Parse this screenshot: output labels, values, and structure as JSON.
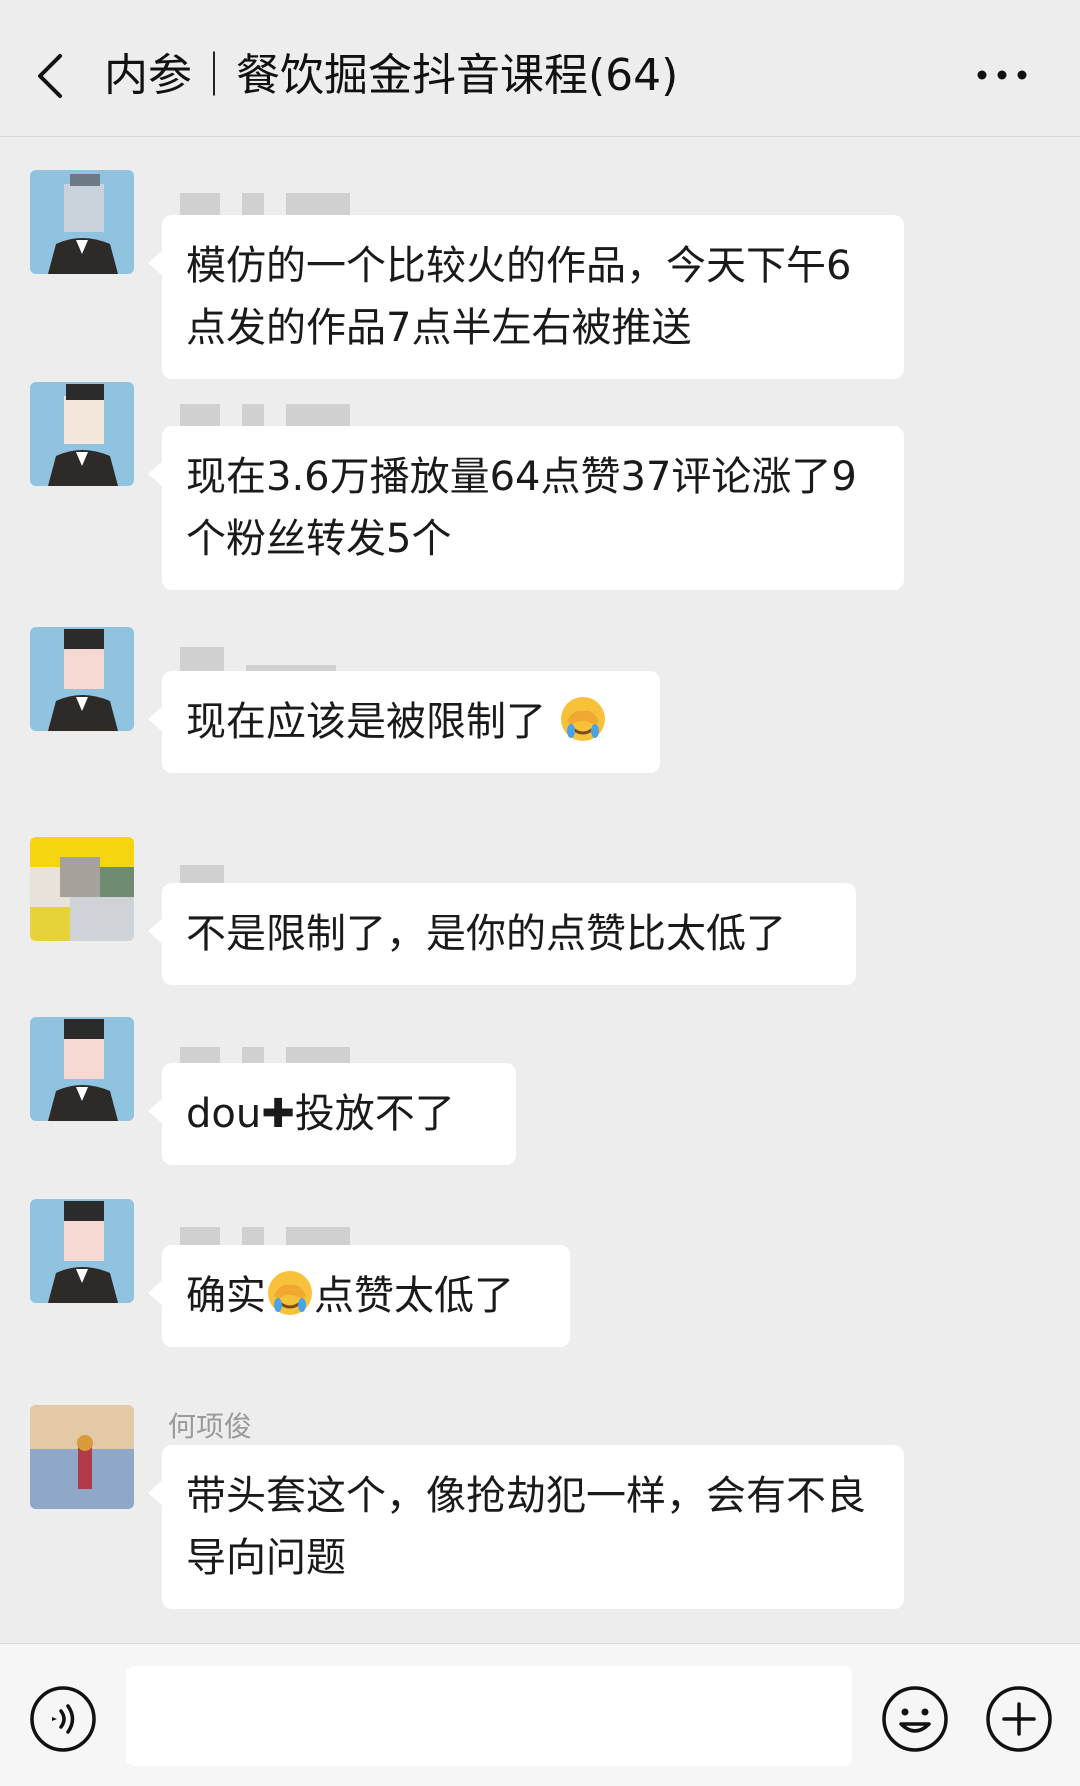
{
  "header": {
    "title": "内参｜餐饮掘金抖音课程(64)"
  },
  "messages": [
    {
      "sender": "",
      "avatar_style": "default",
      "text": "模仿的一个比较火的作品，今天下午6点发的作品7点半左右被推送"
    },
    {
      "sender": "",
      "avatar_style": "default",
      "text": "现在3.6万播放量64点赞37评论涨了9个粉丝转发5个"
    },
    {
      "sender": "",
      "avatar_style": "default",
      "text": "现在应该是被限制了",
      "trailing_emoji": "facepalm-emoji"
    },
    {
      "sender": "",
      "avatar_style": "yellow-photo",
      "text": "不是限制了，是你的点赞比太低了"
    },
    {
      "sender": "",
      "avatar_style": "default",
      "text": "dou✚投放不了"
    },
    {
      "sender": "",
      "avatar_style": "default",
      "text_before": "确实",
      "inline_emoji": "facepalm-emoji",
      "text_after": "点赞太低了"
    },
    {
      "sender": "何项俊",
      "avatar_style": "beach-photo",
      "text": "带头套这个，像抢劫犯一样，会有不良导向问题"
    }
  ],
  "input_bar": {
    "placeholder": "",
    "voice_icon": "voice-icon",
    "emoji_icon": "emoji-icon",
    "plus_icon": "plus-icon"
  },
  "colors": {
    "background": "#ededed",
    "bubble": "#ffffff",
    "avatar_blue": "#8fc3e0",
    "text": "#1a1a1a",
    "sender": "#9a9a9a"
  }
}
